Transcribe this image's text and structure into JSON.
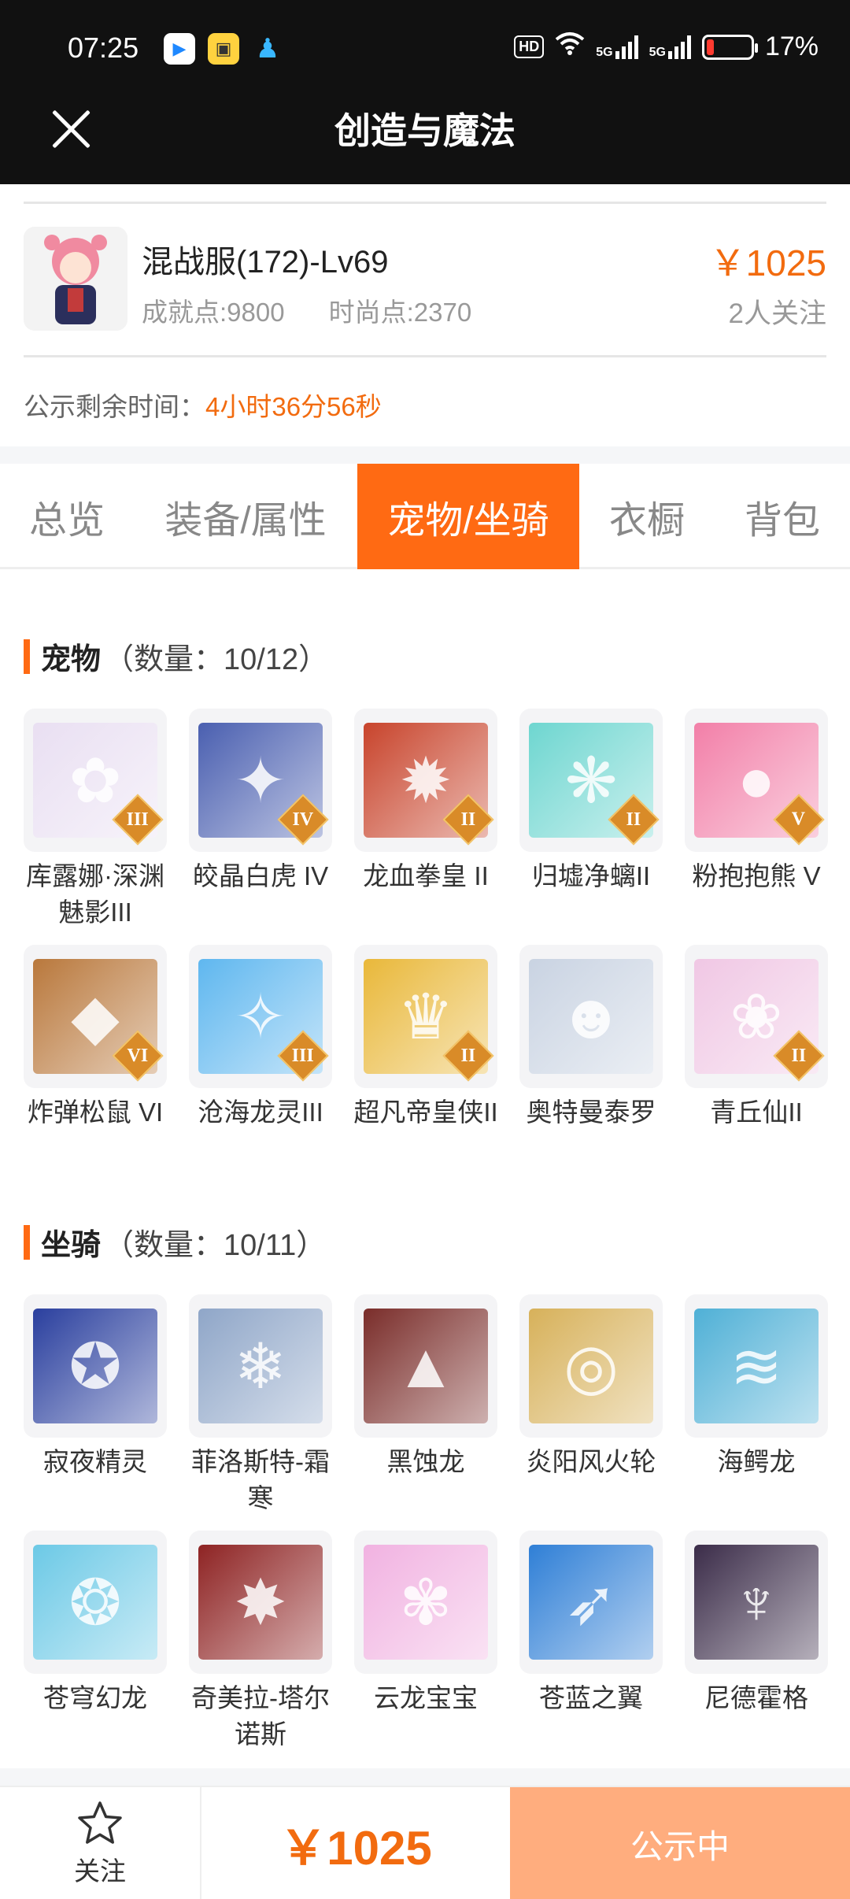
{
  "status_bar": {
    "time": "07:25",
    "network_badge": "HD",
    "signal1": "5G",
    "signal2": "5G",
    "battery_percent": "17%",
    "battery_level": 0.17
  },
  "header": {
    "title": "创造与魔法",
    "close_icon": "close-icon"
  },
  "listing": {
    "name": "混战服(172)-Lv69",
    "achievement": "成就点:9800",
    "fashion": "时尚点:2370",
    "price": "￥1025",
    "followers": "2人关注",
    "publicity_label": "公示剩余时间：",
    "publicity_remaining": "4小时36分56秒"
  },
  "tabs": [
    {
      "label": "总览",
      "active": false
    },
    {
      "label": "装备/属性",
      "active": false
    },
    {
      "label": "宠物/坐骑",
      "active": true
    },
    {
      "label": "衣橱",
      "active": false
    },
    {
      "label": "背包",
      "active": false
    }
  ],
  "pets": {
    "title": "宠物",
    "count": "（数量：10/12）",
    "items": [
      {
        "name": "库露娜·深渊魅影III",
        "tier": "III",
        "color": "#e9dff2",
        "glyph": "✿"
      },
      {
        "name": "皎晶白虎 IV",
        "tier": "IV",
        "color": "#4a5fb0",
        "glyph": "✦"
      },
      {
        "name": "龙血拳皇 II",
        "tier": "II",
        "color": "#c8442c",
        "glyph": "✹"
      },
      {
        "name": "归墟净螭II",
        "tier": "II",
        "color": "#6ed6d0",
        "glyph": "❋"
      },
      {
        "name": "粉抱抱熊 V",
        "tier": "V",
        "color": "#f27fa8",
        "glyph": "●"
      },
      {
        "name": "炸弹松鼠 VI",
        "tier": "VI",
        "color": "#b9783c",
        "glyph": "◆"
      },
      {
        "name": "沧海龙灵III",
        "tier": "III",
        "color": "#5fb7ef",
        "glyph": "✧"
      },
      {
        "name": "超凡帝皇侠II",
        "tier": "II",
        "color": "#e9b83a",
        "glyph": "♛"
      },
      {
        "name": "奥特曼泰罗",
        "tier": "",
        "color": "#c9d3e2",
        "glyph": "☻"
      },
      {
        "name": "青丘仙II",
        "tier": "II",
        "color": "#f0c7e4",
        "glyph": "❀"
      }
    ]
  },
  "mounts": {
    "title": "坐骑",
    "count": "（数量：10/11）",
    "items": [
      {
        "name": "寂夜精灵",
        "tier": "",
        "color": "#2a3f9e",
        "glyph": "✪"
      },
      {
        "name": "菲洛斯特-霜寒",
        "tier": "",
        "color": "#8fa6c8",
        "glyph": "❄"
      },
      {
        "name": "黑蚀龙",
        "tier": "",
        "color": "#7a2d2a",
        "glyph": "▲"
      },
      {
        "name": "炎阳风火轮",
        "tier": "",
        "color": "#d7b15a",
        "glyph": "◎"
      },
      {
        "name": "海鳄龙",
        "tier": "",
        "color": "#4fb0d6",
        "glyph": "≋"
      },
      {
        "name": "苍穹幻龙",
        "tier": "",
        "color": "#6cc9e6",
        "glyph": "❂"
      },
      {
        "name": "奇美拉-塔尔诺斯",
        "tier": "",
        "color": "#8e2323",
        "glyph": "✸"
      },
      {
        "name": "云龙宝宝",
        "tier": "",
        "color": "#f1b2e1",
        "glyph": "✾"
      },
      {
        "name": "苍蓝之翼",
        "tier": "",
        "color": "#2f7fd6",
        "glyph": "➶"
      },
      {
        "name": "尼德霍格",
        "tier": "",
        "color": "#3b2c49",
        "glyph": "♆"
      }
    ]
  },
  "bottom_bar": {
    "follow_label": "关注",
    "price": "￥1025",
    "status_button": "公示中",
    "follow_icon": "star-icon"
  }
}
